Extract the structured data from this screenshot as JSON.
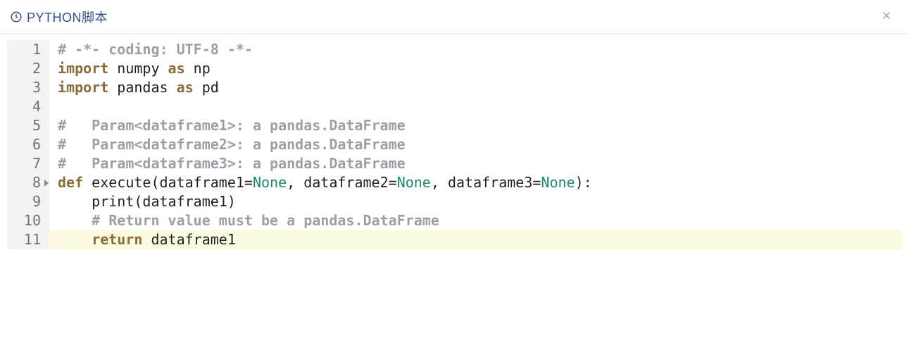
{
  "header": {
    "title": "PYTHON脚本"
  },
  "editor": {
    "active_line": 11,
    "lines": [
      {
        "n": 1,
        "fold": false,
        "tokens": [
          {
            "c": "tok-comment",
            "t": "# -*- coding: UTF-8 -*-"
          }
        ]
      },
      {
        "n": 2,
        "fold": false,
        "tokens": [
          {
            "c": "tok-kw",
            "t": "import"
          },
          {
            "c": "tok-id",
            "t": " numpy "
          },
          {
            "c": "tok-kw",
            "t": "as"
          },
          {
            "c": "tok-id",
            "t": " np"
          }
        ]
      },
      {
        "n": 3,
        "fold": false,
        "tokens": [
          {
            "c": "tok-kw",
            "t": "import"
          },
          {
            "c": "tok-id",
            "t": " pandas "
          },
          {
            "c": "tok-kw",
            "t": "as"
          },
          {
            "c": "tok-id",
            "t": " pd"
          }
        ]
      },
      {
        "n": 4,
        "fold": false,
        "tokens": []
      },
      {
        "n": 5,
        "fold": false,
        "tokens": [
          {
            "c": "tok-comment",
            "t": "#   Param<dataframe1>: a pandas.DataFrame"
          }
        ]
      },
      {
        "n": 6,
        "fold": false,
        "tokens": [
          {
            "c": "tok-comment",
            "t": "#   Param<dataframe2>: a pandas.DataFrame"
          }
        ]
      },
      {
        "n": 7,
        "fold": false,
        "tokens": [
          {
            "c": "tok-comment",
            "t": "#   Param<dataframe3>: a pandas.DataFrame"
          }
        ]
      },
      {
        "n": 8,
        "fold": true,
        "tokens": [
          {
            "c": "tok-kw",
            "t": "def"
          },
          {
            "c": "tok-id",
            "t": " execute(dataframe1"
          },
          {
            "c": "tok-punc",
            "t": "="
          },
          {
            "c": "tok-builtin",
            "t": "None"
          },
          {
            "c": "tok-punc",
            "t": ", "
          },
          {
            "c": "tok-id",
            "t": "dataframe2"
          },
          {
            "c": "tok-punc",
            "t": "="
          },
          {
            "c": "tok-builtin",
            "t": "None"
          },
          {
            "c": "tok-punc",
            "t": ", "
          },
          {
            "c": "tok-id",
            "t": "dataframe3"
          },
          {
            "c": "tok-punc",
            "t": "="
          },
          {
            "c": "tok-builtin",
            "t": "None"
          },
          {
            "c": "tok-punc",
            "t": "):"
          }
        ]
      },
      {
        "n": 9,
        "fold": false,
        "tokens": [
          {
            "c": "tok-id",
            "t": "    print(dataframe1)"
          }
        ]
      },
      {
        "n": 10,
        "fold": false,
        "tokens": [
          {
            "c": "tok-id",
            "t": "    "
          },
          {
            "c": "tok-comment",
            "t": "# Return value must be a pandas.DataFrame"
          }
        ]
      },
      {
        "n": 11,
        "fold": false,
        "tokens": [
          {
            "c": "tok-id",
            "t": "    "
          },
          {
            "c": "tok-kw",
            "t": "return"
          },
          {
            "c": "tok-id",
            "t": " dataframe1"
          }
        ]
      }
    ]
  }
}
